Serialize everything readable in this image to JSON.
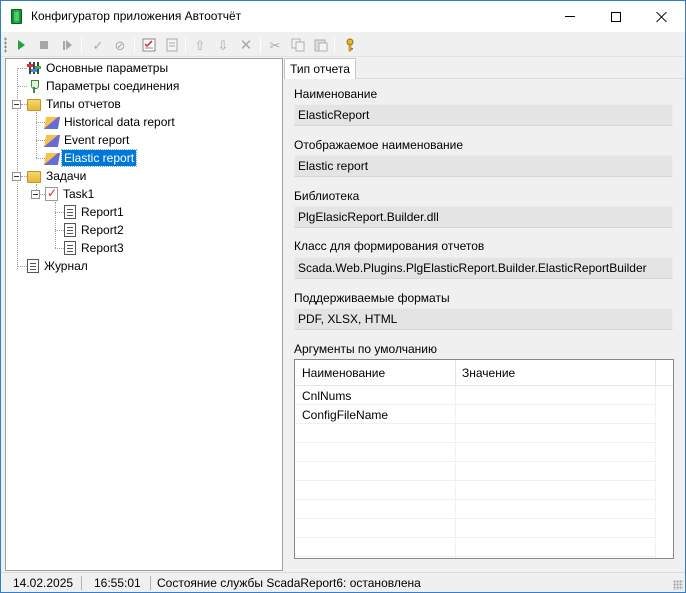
{
  "window": {
    "title": "Конфигуратор приложения Автоотчёт"
  },
  "toolbar": {
    "buttons": [
      {
        "name": "start-icon",
        "enabled": true
      },
      {
        "name": "stop-icon",
        "enabled": false
      },
      {
        "name": "step-icon",
        "enabled": false
      },
      {
        "name": "apply-icon",
        "enabled": false
      },
      {
        "name": "cancel-icon",
        "enabled": false
      },
      {
        "name": "checklist-icon",
        "enabled": true
      },
      {
        "name": "document-icon",
        "enabled": false
      },
      {
        "name": "move-up-icon",
        "enabled": false
      },
      {
        "name": "move-down-icon",
        "enabled": false
      },
      {
        "name": "delete-icon",
        "enabled": false
      },
      {
        "name": "cut-icon",
        "enabled": false
      },
      {
        "name": "copy-icon",
        "enabled": false
      },
      {
        "name": "paste-icon",
        "enabled": false
      },
      {
        "name": "key-icon",
        "enabled": true
      }
    ]
  },
  "tree": {
    "general": "Основные параметры",
    "connection": "Параметры соединения",
    "report_types": "Типы отчетов",
    "historical": "Historical data report",
    "event": "Event report",
    "elastic": "Elastic report",
    "tasks": "Задачи",
    "task1": "Task1",
    "report1": "Report1",
    "report2": "Report2",
    "report3": "Report3",
    "journal": "Журнал"
  },
  "tab": {
    "label": "Тип отчета"
  },
  "form": {
    "name_label": "Наименование",
    "name_value": "ElasticReport",
    "display_label": "Отображаемое наименование",
    "display_value": "Elastic report",
    "library_label": "Библиотека",
    "library_value": "PlgElasicReport.Builder.dll",
    "class_label": "Класс для формирования отчетов",
    "class_value": "Scada.Web.Plugins.PlgElasticReport.Builder.ElasticReportBuilder",
    "formats_label": "Поддерживаемые форматы",
    "formats_value": "PDF, XLSX, HTML",
    "args_label": "Аргументы по умолчанию"
  },
  "args_grid": {
    "col_name": "Наименование",
    "col_value": "Значение",
    "rows": [
      {
        "name": "CnlNums",
        "value": ""
      },
      {
        "name": "ConfigFileName",
        "value": ""
      }
    ]
  },
  "status": {
    "date": "14.02.2025",
    "time": "16:55:01",
    "service": "Состояние службы ScadaReport6: остановлена"
  },
  "colors": {
    "selection": "#0078d7",
    "window_border": "#2f7fd0",
    "start_green": "#1fa33a"
  }
}
